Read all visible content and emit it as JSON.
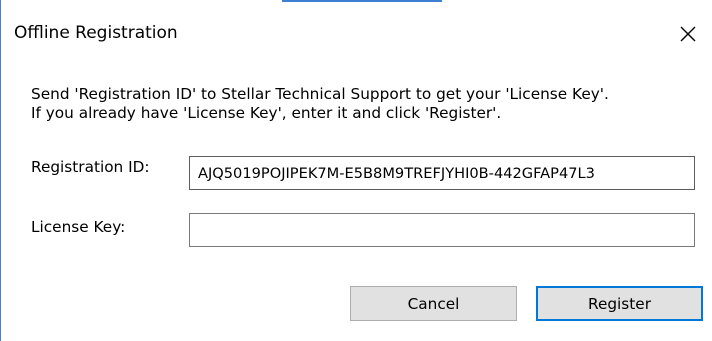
{
  "dialog": {
    "title": "Offline Registration",
    "close_symbol": "close-icon",
    "message_line1": "Send 'Registration ID' to Stellar Technical Support to get your 'License Key'.",
    "message_line2": "If you already have 'License Key', enter it and click 'Register'.",
    "registration_id_label": "Registration ID:",
    "registration_id_value": "AJQ5019POJIPEK7M-E5B8M9TREFJYHI0B-442GFAP47L3",
    "license_key_label": "License Key:",
    "license_key_value": "",
    "cancel_label": "Cancel",
    "register_label": "Register"
  },
  "colors": {
    "accent": "#0078d7",
    "button_face": "#e1e1e1",
    "window_edge": "#4b80c6"
  }
}
